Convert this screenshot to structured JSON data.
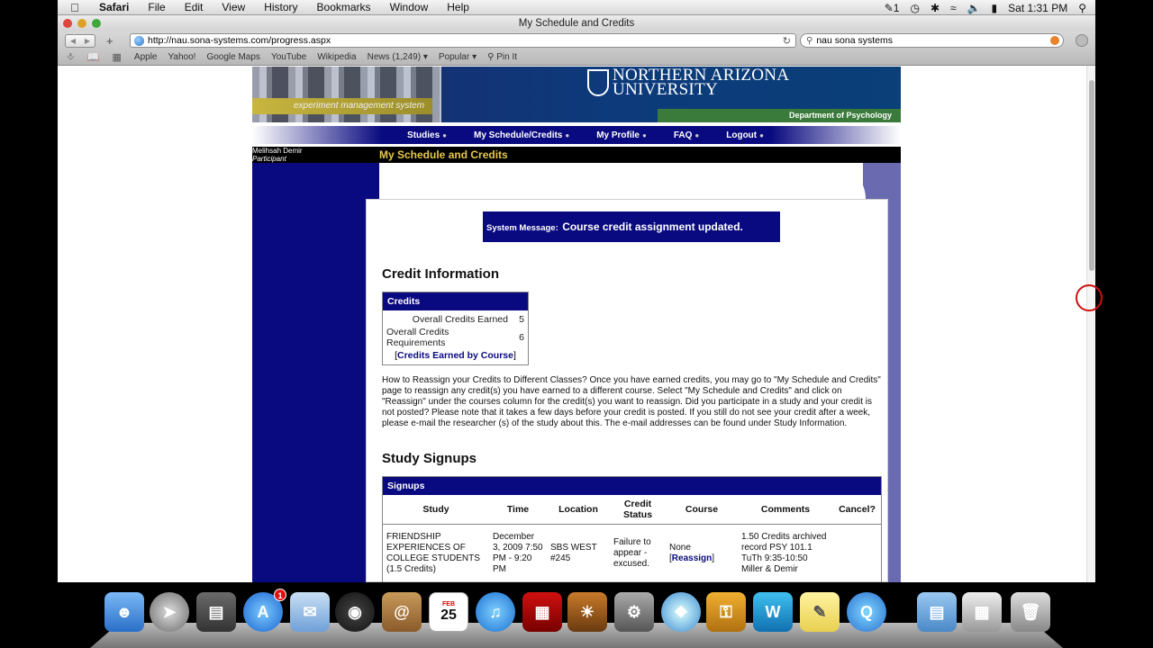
{
  "menubar": {
    "app": "Safari",
    "items": [
      "File",
      "Edit",
      "View",
      "History",
      "Bookmarks",
      "Window",
      "Help"
    ],
    "status_num": "1",
    "clock": "Sat 1:31 PM"
  },
  "window": {
    "title": "My Schedule and Credits",
    "url": "http://nau.sona-systems.com/progress.aspx",
    "search": "nau sona systems"
  },
  "bookmarks": [
    "Apple",
    "Yahoo!",
    "Google Maps",
    "YouTube",
    "Wikipedia",
    "News (1,249) ▾",
    "Popular ▾",
    "Pin It"
  ],
  "banner": {
    "tagline": "experiment management system",
    "logo_line1": "NORTHERN ARIZONA",
    "logo_line2": "UNIVERSITY",
    "department": "Department of Psychology"
  },
  "nav": [
    "Studies",
    "My Schedule/Credits",
    "My Profile",
    "FAQ",
    "Logout"
  ],
  "user": {
    "name": "Melihsah Demir",
    "role": "Participant"
  },
  "page_title": "My Schedule and Credits",
  "system_message": {
    "label": "System Message:",
    "text": "Course credit assignment updated."
  },
  "credit_info": {
    "heading": "Credit Information",
    "table_header": "Credits",
    "earned_label": "Overall Credits Earned",
    "earned_value": "5",
    "required_label": "Overall Credits Requirements",
    "required_value": "6",
    "link_label": "Credits Earned by Course",
    "help_text": "How to Reassign your Credits to Different Classes? Once you have earned credits, you may go to \"My Schedule and Credits\" page to reassign any credit(s) you have earned to a different course. Select \"My Schedule and Credits\" and click on \"Reassign\" under the courses column for the credit(s) you want to reassign. Did you participate in a study and your credit is not posted? Please note that it takes a few days before your credit is posted. If you still do not see your credit after a week, please e-mail the researcher (s) of the study about this. The e-mail addresses can be found under Study Information."
  },
  "signups": {
    "heading": "Study Signups",
    "table_header": "Signups",
    "columns": [
      "Study",
      "Time",
      "Location",
      "Credit Status",
      "Course",
      "Comments",
      "Cancel?"
    ],
    "rows": [
      {
        "study": "FRIENDSHIP EXPERIENCES OF COLLEGE STUDENTS (1.5 Credits)",
        "time": "December 3, 2009 7:50 PM - 9:20 PM",
        "location": "SBS WEST #245",
        "status": "Failure to appear - excused.",
        "course": "None",
        "course_link": "Reassign",
        "comments": "1.50 Credits archived record PSY 101.1 TuTh 9:35-10:50 Miller & Demir"
      }
    ]
  },
  "dock": {
    "appstore_badge": "1",
    "calendar_date": "25",
    "calendar_month": "FEB"
  }
}
